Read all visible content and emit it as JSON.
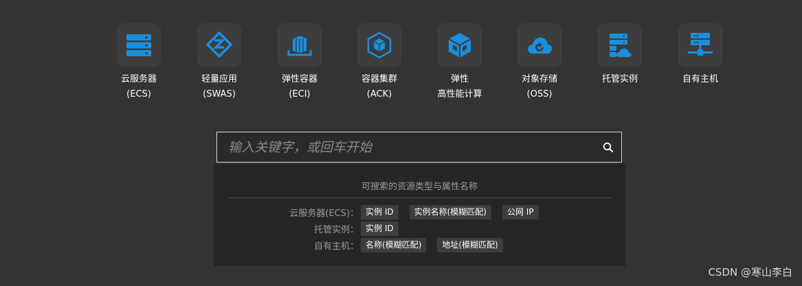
{
  "colors": {
    "background": "#333333",
    "tile": "#3d3d3d",
    "icon_blue": "#1a8fe0",
    "panel": "#262626",
    "chip": "#3d3d3d"
  },
  "products": [
    {
      "icon": "server-stack-icon",
      "line1": "云服务器",
      "line2": "(ECS)"
    },
    {
      "icon": "light-server-icon",
      "line1": "轻量应用",
      "line2": "(SWAS)"
    },
    {
      "icon": "container-icon",
      "line1": "弹性容器",
      "line2": "(ECI)"
    },
    {
      "icon": "cluster-cube-icon",
      "line1": "容器集群",
      "line2": "(ACK)"
    },
    {
      "icon": "hpc-cube-icon",
      "line1": "弹性",
      "line2": "高性能计算"
    },
    {
      "icon": "cloud-storage-icon",
      "line1": "对象存储",
      "line2": "(OSS)"
    },
    {
      "icon": "hosted-instance-icon",
      "line1": "托管实例",
      "line2": ""
    },
    {
      "icon": "own-host-icon",
      "line1": "自有主机",
      "line2": ""
    }
  ],
  "search": {
    "placeholder": "输入关键字，或回车开始",
    "value": ""
  },
  "panel": {
    "title": "可搜索的资源类型与属性名称",
    "rows": [
      {
        "label": "云服务器(ECS)：",
        "chips": [
          "实例 ID",
          "实例名称(模糊匹配)",
          "公网 IP"
        ]
      },
      {
        "label": "托管实例：",
        "chips": [
          "实例 ID"
        ]
      },
      {
        "label": "自有主机：",
        "chips": [
          "名称(模糊匹配)",
          "地址(模糊匹配)"
        ]
      }
    ]
  },
  "watermark": "CSDN @寒山李白"
}
